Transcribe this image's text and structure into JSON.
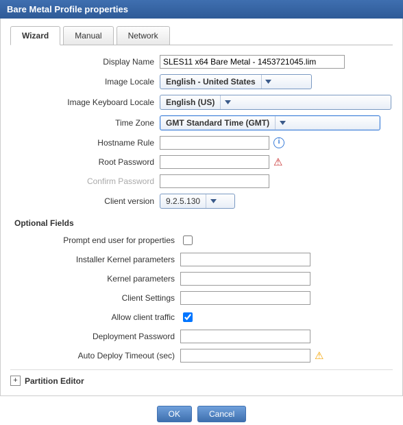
{
  "window": {
    "title": "Bare Metal Profile properties"
  },
  "tabs": {
    "wizard": "Wizard",
    "manual": "Manual",
    "network": "Network"
  },
  "labels": {
    "display_name": "Display Name",
    "image_locale": "Image Locale",
    "image_keyboard_locale": "Image Keyboard Locale",
    "time_zone": "Time Zone",
    "hostname_rule": "Hostname Rule",
    "root_password": "Root Password",
    "confirm_password": "Confirm Password",
    "client_version": "Client version",
    "optional_fields": "Optional Fields",
    "prompt_end_user": "Prompt end user for properties",
    "installer_kernel_params": "Installer Kernel parameters",
    "kernel_params": "Kernel parameters",
    "client_settings": "Client Settings",
    "allow_client_traffic": "Allow client traffic",
    "deployment_password": "Deployment Password",
    "auto_deploy_timeout": "Auto Deploy Timeout (sec)",
    "partition_editor": "Partition Editor"
  },
  "values": {
    "display_name": "SLES11 x64 Bare Metal - 1453721045.lim",
    "image_locale": "English - United States",
    "image_keyboard_locale": "English (US)",
    "time_zone": "GMT Standard Time (GMT)",
    "hostname_rule": "",
    "root_password": "",
    "confirm_password": "",
    "client_version": "9.2.5.130",
    "prompt_end_user_checked": false,
    "installer_kernel_params": "",
    "kernel_params": "",
    "client_settings": "",
    "allow_client_traffic_checked": true,
    "deployment_password": "",
    "auto_deploy_timeout": ""
  },
  "icons": {
    "info": "i",
    "warn_red": "⚠",
    "warn_yellow": "⚠",
    "expand_plus": "+"
  },
  "buttons": {
    "ok": "OK",
    "cancel": "Cancel"
  }
}
